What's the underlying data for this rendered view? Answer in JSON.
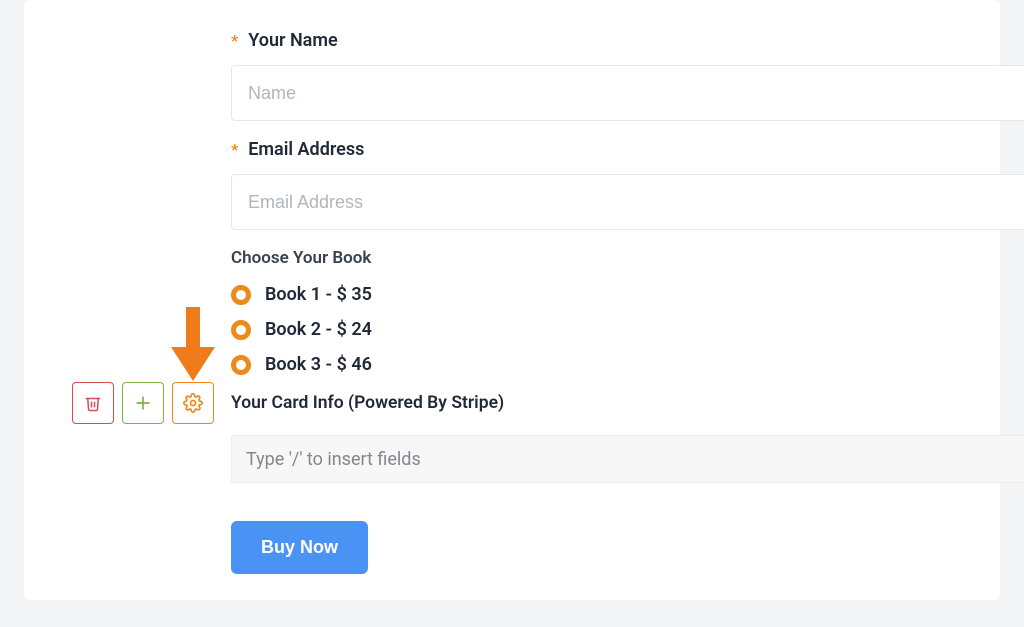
{
  "form": {
    "name": {
      "label": "Your Name",
      "placeholder": "Name",
      "required": true
    },
    "email": {
      "label": "Email Address",
      "placeholder": "Email Address",
      "required": true
    },
    "book_section": {
      "label": "Choose Your Book",
      "options": [
        "Book 1 - $ 35",
        "Book 2 - $ 24",
        "Book 3 - $ 46"
      ]
    },
    "card_info": {
      "label": "Your Card Info (Powered By Stripe)",
      "placeholder": "Type '/' to insert fields"
    },
    "submit_label": "Buy Now"
  },
  "toolbox": {
    "delete": "trash-icon",
    "add": "plus-icon",
    "settings": "gear-icon"
  }
}
